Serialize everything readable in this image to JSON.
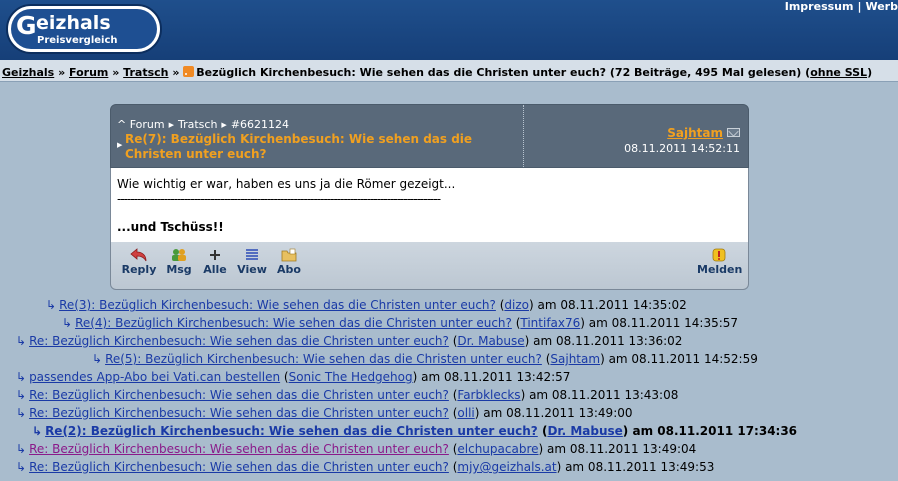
{
  "header": {
    "logo_text": "Geizhals",
    "logo_sub": "Preisvergleich",
    "links": [
      "Impressum",
      "Werb"
    ]
  },
  "breadcrumb": {
    "home": "Geizhals",
    "forum": "Forum",
    "section": "Tratsch",
    "sep": "»",
    "thread_title": "Bezüglich Kirchenbesuch: Wie sehen das die Christen unter euch? (72 Beiträge, 495 Mal gelesen)",
    "ssl_link": "ohne SSL",
    "ssl_open": "(",
    "ssl_close": ")"
  },
  "post": {
    "nav": {
      "up": "^",
      "forum": "Forum",
      "section": "Tratsch",
      "id": "#6621124"
    },
    "title": "Re(7): Bezüglich Kirchenbesuch: Wie sehen das die Christen unter euch?",
    "author": "Sajhtam",
    "date": "08.11.2011 14:52:11",
    "body_line1": "Wie wichtig er war, haben es uns ja die Römer gezeigt...",
    "body_rule": "-------------------------------------------------------------------------------------------------",
    "body_line2": "...und Tschüss!!",
    "buttons": {
      "reply": "Reply",
      "msg": "Msg",
      "alle": "Alle",
      "view": "View",
      "abo": "Abo",
      "melden": "Melden"
    }
  },
  "thread": [
    {
      "title": "Re(3): Bezüglich Kirchenbesuch: Wie sehen das die Christen unter euch?",
      "author": "dizo",
      "date": "am 08.11.2011 14:35:02",
      "visited": false,
      "current": false
    },
    {
      "title": "Re(4): Bezüglich Kirchenbesuch: Wie sehen das die Christen unter euch?",
      "author": "Tintifax76",
      "date": "am 08.11.2011 14:35:57",
      "visited": false,
      "current": false
    },
    {
      "title": "Re: Bezüglich Kirchenbesuch: Wie sehen das die Christen unter euch?",
      "author": "Dr. Mabuse",
      "date": "am 08.11.2011 13:36:02",
      "visited": false,
      "current": false
    },
    {
      "title": "Re(5): Bezüglich Kirchenbesuch: Wie sehen das die Christen unter euch?",
      "author": "Sajhtam",
      "date": "am 08.11.2011 14:52:59",
      "visited": false,
      "current": false
    },
    {
      "title": "passendes App-Abo bei Vati.can bestellen",
      "author": "Sonic The Hedgehog",
      "date": "am 08.11.2011 13:42:57",
      "visited": false,
      "current": false
    },
    {
      "title": "Re: Bezüglich Kirchenbesuch: Wie sehen das die Christen unter euch?",
      "author": "Farbklecks",
      "date": "am 08.11.2011 13:43:08",
      "visited": false,
      "current": false
    },
    {
      "title": "Re: Bezüglich Kirchenbesuch: Wie sehen das die Christen unter euch?",
      "author": "olli",
      "date": "am 08.11.2011 13:49:00",
      "visited": false,
      "current": false
    },
    {
      "title": "Re(2): Bezüglich Kirchenbesuch: Wie sehen das die Christen unter euch?",
      "author": "Dr. Mabuse",
      "date": "am 08.11.2011 17:34:36",
      "visited": false,
      "current": true
    },
    {
      "title": "Re: Bezüglich Kirchenbesuch: Wie sehen das die Christen unter euch?",
      "author": "elchupacabre",
      "date": "am 08.11.2011 13:49:04",
      "visited": true,
      "current": false
    },
    {
      "title": "Re: Bezüglich Kirchenbesuch: Wie sehen das die Christen unter euch?",
      "author": "mjy@geizhals.at",
      "date": "am 08.11.2011 13:49:53",
      "visited": false,
      "current": false
    }
  ]
}
